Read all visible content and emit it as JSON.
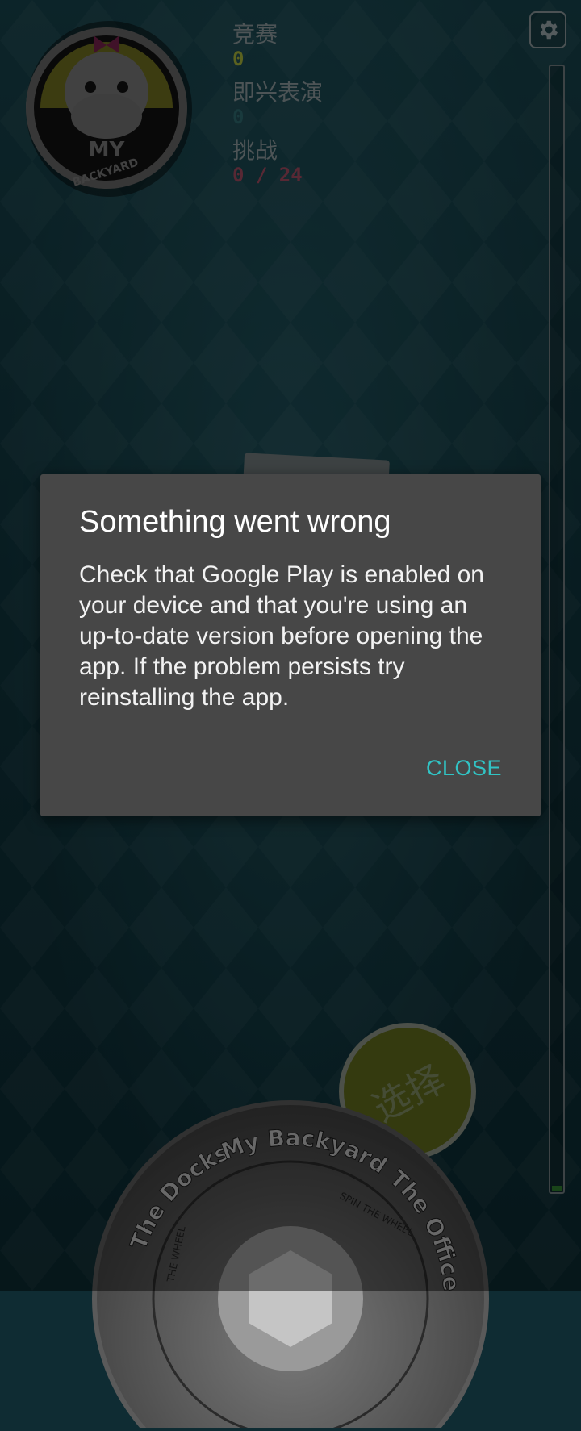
{
  "stats": [
    {
      "label": "竞赛",
      "value": "0"
    },
    {
      "label": "即兴表演",
      "value": "0"
    },
    {
      "label": "挑战",
      "value": "0 / 24"
    }
  ],
  "badge": {
    "line1": "MY",
    "line2": "BACKYARD"
  },
  "settings": {
    "icon": "gear-icon"
  },
  "progress": {
    "fraction": 0.0
  },
  "select_button": {
    "label": "选择"
  },
  "wheel": {
    "labels": [
      "The Docks",
      "My Backyard",
      "The Office"
    ],
    "inner_text_1": "SPIN THE WHEEL",
    "inner_text_2": "THE WHEEL"
  },
  "dialog": {
    "title": "Something went wrong",
    "message": "Check that Google Play is enabled on your device and that you're using an up-to-date version before opening the app. If the problem persists try reinstalling the app.",
    "close_label": "CLOSE"
  },
  "colors": {
    "accent": "#31c3c4",
    "dialog_bg": "#474747",
    "stat_green": "#a6b23a",
    "stat_pink": "#a04a5f"
  }
}
